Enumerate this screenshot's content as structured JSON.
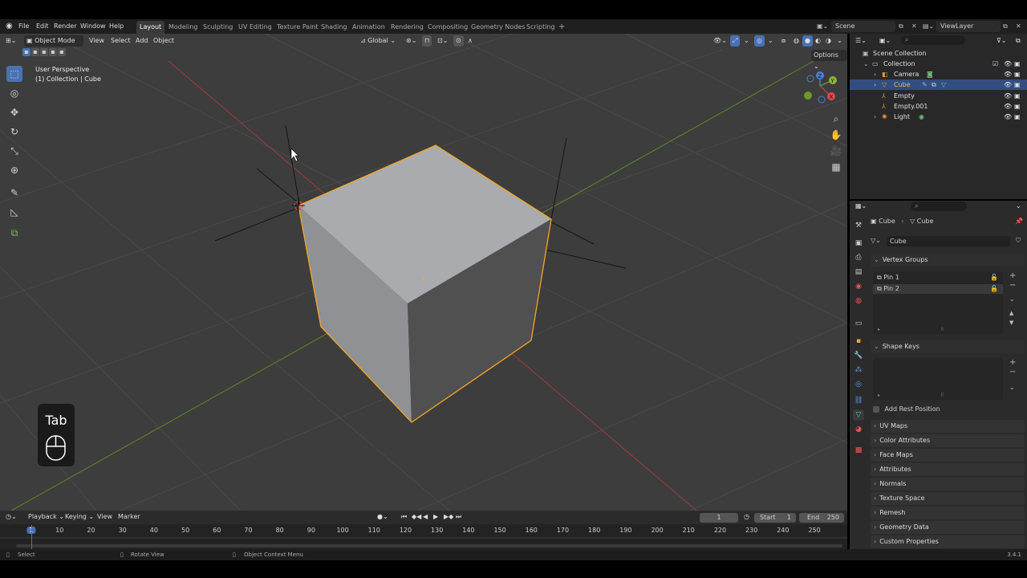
{
  "menu": {
    "items": [
      "File",
      "Edit",
      "Render",
      "Window",
      "Help"
    ],
    "workspaces": [
      "Layout",
      "Modeling",
      "Sculpting",
      "UV Editing",
      "Texture Paint",
      "Shading",
      "Animation",
      "Rendering",
      "Compositing",
      "Geometry Nodes",
      "Scripting"
    ],
    "active_workspace": "Layout",
    "scene": "Scene",
    "view_layer": "ViewLayer"
  },
  "viewport": {
    "mode": "Object Mode",
    "menu": [
      "View",
      "Select",
      "Add",
      "Object"
    ],
    "transform_orientation": "Global",
    "options": "Options",
    "info_line1": "User Perspective",
    "info_line2": "(1) Collection | Cube",
    "gizmo_axes": [
      "Z",
      "Y",
      "X"
    ],
    "key_overlay": "Tab"
  },
  "outliner": {
    "rows": [
      {
        "label": "Scene Collection",
        "indent": 0
      },
      {
        "label": "Collection",
        "indent": 1
      },
      {
        "label": "Camera",
        "indent": 2
      },
      {
        "label": "Cube",
        "indent": 2,
        "selected": true
      },
      {
        "label": "Empty",
        "indent": 2
      },
      {
        "label": "Empty.001",
        "indent": 2
      },
      {
        "label": "Light",
        "indent": 2
      }
    ]
  },
  "properties": {
    "breadcrumb_object": "Cube",
    "breadcrumb_data": "Cube",
    "mesh_name": "Cube",
    "vertex_groups_title": "Vertex Groups",
    "vertex_groups": [
      "Pin 1",
      "Pin 2"
    ],
    "shape_keys_title": "Shape Keys",
    "add_rest_position": "Add Rest Position",
    "panels": [
      "UV Maps",
      "Color Attributes",
      "Face Maps",
      "Attributes",
      "Normals",
      "Texture Space",
      "Remesh",
      "Geometry Data",
      "Custom Properties"
    ]
  },
  "timeline": {
    "menu": [
      "Playback",
      "Keying",
      "View",
      "Marker"
    ],
    "current_frame": "1",
    "start_label": "Start",
    "start": "1",
    "end_label": "End",
    "end": "250",
    "ticks": [
      "1",
      "10",
      "20",
      "30",
      "40",
      "50",
      "60",
      "70",
      "80",
      "90",
      "100",
      "110",
      "120",
      "130",
      "140",
      "150",
      "160",
      "170",
      "180",
      "190",
      "200",
      "210",
      "220",
      "230",
      "240",
      "250"
    ]
  },
  "status": {
    "select": "Select",
    "rotate": "Rotate View",
    "context": "Object Context Menu",
    "version": "3.4.1"
  },
  "colors": {
    "accent": "#4772b3",
    "selection": "#f5a623",
    "x_axis": "#c83a3a",
    "y_axis": "#6a9a2a"
  }
}
